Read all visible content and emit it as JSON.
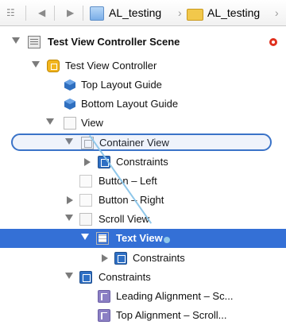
{
  "jumpbar": {
    "grid_icon": "grid-icon",
    "crumbs": [
      {
        "label": "AL_testing",
        "icon": "xcode-project-icon"
      },
      {
        "label": "AL_testing",
        "icon": "folder-icon"
      }
    ]
  },
  "tree": {
    "scene_title": "Test View Controller Scene",
    "view_controller": "Test View Controller",
    "top_layout_guide": "Top Layout Guide",
    "bottom_layout_guide": "Bottom Layout Guide",
    "view": "View",
    "container_view": "Container View",
    "container_constraints": "Constraints",
    "button_left": "Button – Left",
    "button_right": "Button – Right",
    "scroll_view": "Scroll View",
    "text_view": "Text View",
    "text_constraints": "Constraints",
    "view_constraints": "Constraints",
    "leading_alignment": "Leading Alignment – Sc...",
    "top_alignment": "Top Alignment – Scroll..."
  }
}
